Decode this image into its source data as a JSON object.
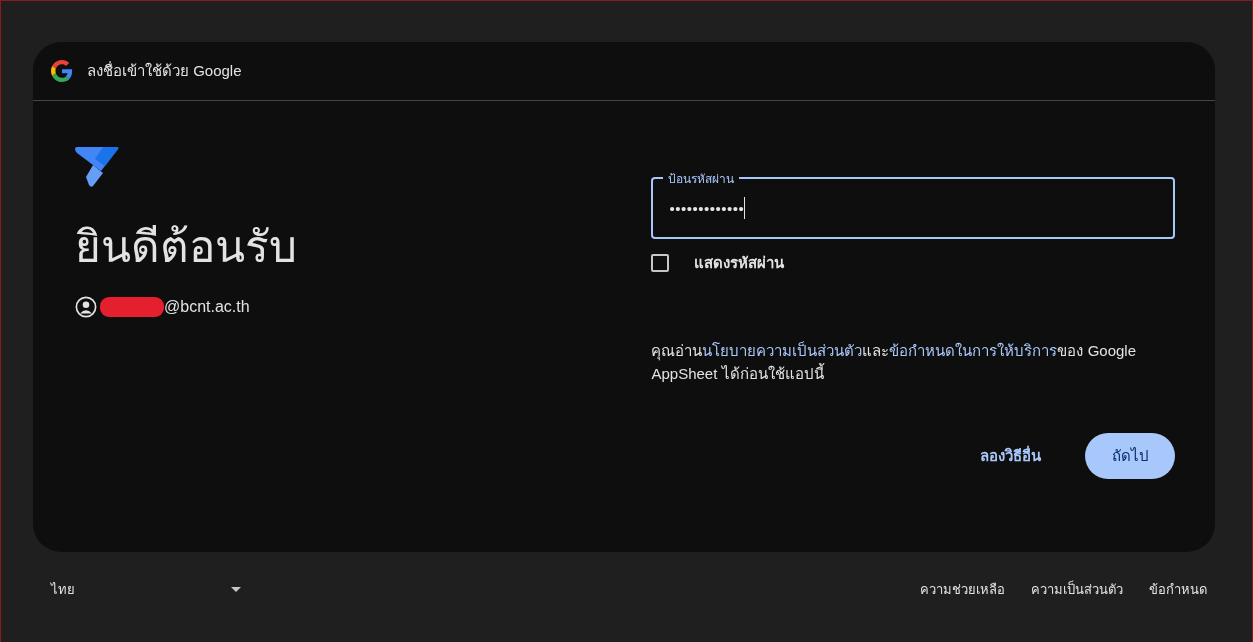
{
  "header": {
    "title": "ลงชื่อเข้าใช้ด้วย Google"
  },
  "welcome": {
    "heading": "ยินดีต้อนรับ",
    "account": {
      "email": "@bcnt.ac.th",
      "redacted": true
    }
  },
  "password": {
    "label": "ป้อนรหัสผ่าน",
    "value": "•••••••••••••",
    "focused": true
  },
  "show_password": {
    "label": "แสดงรหัสผ่าน",
    "checked": false
  },
  "consent": [
    {
      "kind": "plain",
      "text": "คุณอ่าน"
    },
    {
      "kind": "link",
      "text": "นโยบายความเป็นส่วนตัว"
    },
    {
      "kind": "plain",
      "text": "และ"
    },
    {
      "kind": "link",
      "text": "ข้อกำหนดในการให้บริการ"
    },
    {
      "kind": "plain",
      "text": "ของ Google AppSheet ได้ก่อนใช้แอปนี้"
    }
  ],
  "buttons": [
    {
      "kind": "text",
      "label": "ลองวิธีอื่น"
    },
    {
      "kind": "filled",
      "label": "ถัดไป"
    }
  ],
  "footer": {
    "language": "ไทย",
    "links": [
      "ความช่วยเหลือ",
      "ความเป็นส่วนตัว",
      "ข้อกำหนด"
    ]
  }
}
